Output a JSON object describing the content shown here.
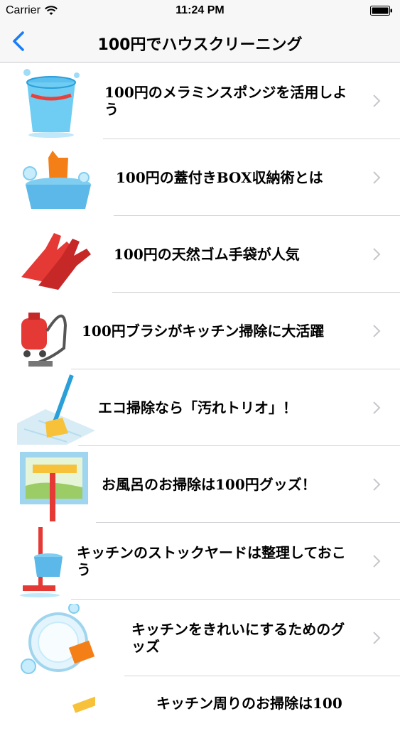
{
  "status_bar": {
    "carrier": "Carrier",
    "time": "11:24 PM",
    "wifi_icon": "wifi-icon",
    "battery_icon": "battery-icon"
  },
  "nav": {
    "back_icon": "chevron-left-icon",
    "title": "100円でハウスクリーニング",
    "accent_color": "#1a7df5"
  },
  "list": {
    "chevron_icon": "chevron-right-icon",
    "items": [
      {
        "label": "100円のメラミンスポンジを活用しよう",
        "icon": "water-bucket-icon"
      },
      {
        "label": "100円の蓋付きBOX収納術とは",
        "icon": "laundry-basin-icon"
      },
      {
        "label": "100円の天然ゴム手袋が人気",
        "icon": "rubber-gloves-icon"
      },
      {
        "label": "100円ブラシがキッチン掃除に大活躍",
        "icon": "vacuum-cleaner-icon"
      },
      {
        "label": "エコ掃除なら「汚れトリオ」！",
        "icon": "broom-icon"
      },
      {
        "label": "お風呂のお掃除は100円グッズ！",
        "icon": "window-squeegee-icon"
      },
      {
        "label": "キッチンのストックヤードは整理しておこう",
        "icon": "mop-bucket-icon"
      },
      {
        "label": "キッチンをきれいにするためのグッズ",
        "icon": "plate-sponge-icon"
      },
      {
        "label": "キッチン周りのお掃除は100",
        "icon": "spray-hose-icon"
      }
    ]
  }
}
